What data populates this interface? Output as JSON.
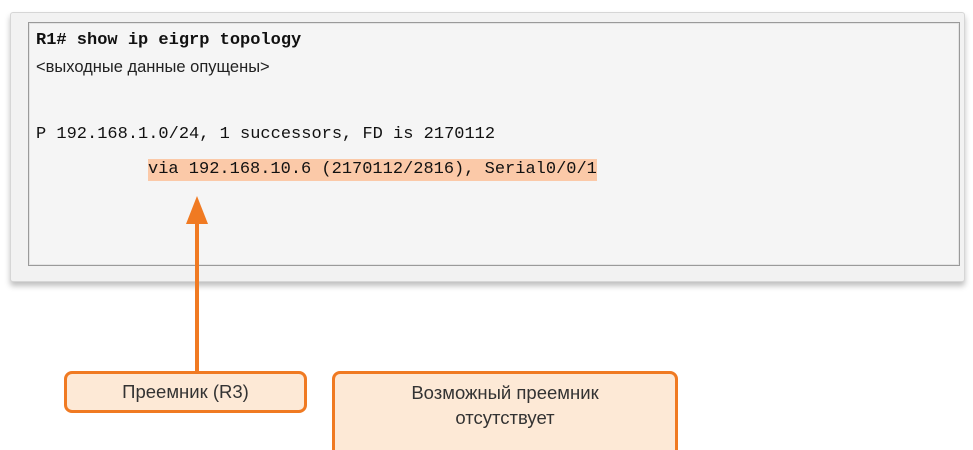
{
  "terminal": {
    "command": "R1# show ip eigrp topology",
    "omitted_note": "<выходные данные опущены>",
    "route_line": "P 192.168.1.0/24, 1 successors, FD is 2170112",
    "via_line": "via 192.168.10.6 (2170112/2816), Serial0/0/1"
  },
  "callouts": {
    "successor": "Преемник (R3)",
    "feasible_successor_line1": "Возможный преемник",
    "feasible_successor_line2": "отсутствует"
  },
  "colors": {
    "accent_orange": "#f07a22",
    "highlight": "#fbc9a8",
    "callout_fill": "#fde9d6"
  }
}
